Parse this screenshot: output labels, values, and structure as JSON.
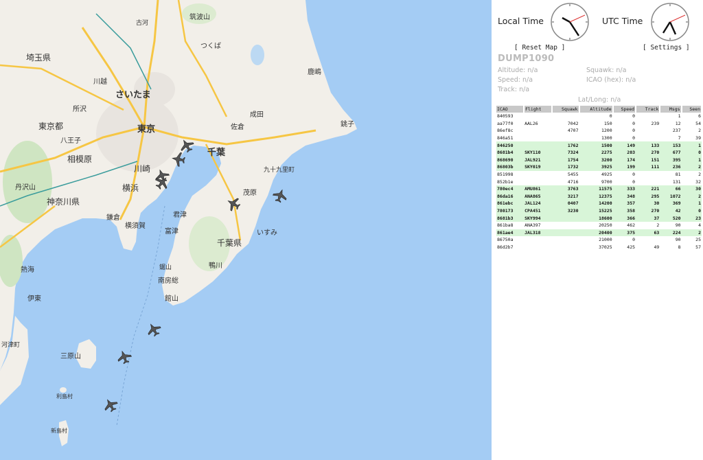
{
  "panel": {
    "local_time_label": "Local Time",
    "utc_time_label": "UTC Time",
    "reset_map_label": "[ Reset Map ]",
    "settings_label": "[ Settings ]",
    "app_title": "DUMP1090",
    "altitude": "Altitude: n/a",
    "squawk": "Squawk: n/a",
    "speed": "Speed: n/a",
    "icao": "ICAO (hex): n/a",
    "track": "Track: n/a",
    "latlong": "Lat/Long: n/a"
  },
  "table": {
    "headers": [
      "ICAO",
      "Flight",
      "Squawk",
      "Altitude",
      "Speed",
      "Track",
      "Msgs",
      "Seen"
    ],
    "rows": [
      {
        "icao": "840593",
        "flight": "",
        "squawk": "",
        "altitude": "0",
        "speed": "0",
        "track": "",
        "msgs": "1",
        "seen": "6",
        "pos": false
      },
      {
        "icao": "aa77f0",
        "flight": "AAL26",
        "squawk": "7042",
        "altitude": "150",
        "speed": "0",
        "track": "239",
        "msgs": "12",
        "seen": "54",
        "pos": false
      },
      {
        "icao": "86ef8c",
        "flight": "",
        "squawk": "4707",
        "altitude": "1200",
        "speed": "0",
        "track": "",
        "msgs": "237",
        "seen": "2",
        "pos": false
      },
      {
        "icao": "846a51",
        "flight": "",
        "squawk": "",
        "altitude": "1300",
        "speed": "0",
        "track": "",
        "msgs": "7",
        "seen": "39",
        "pos": false
      },
      {
        "icao": "846250",
        "flight": "",
        "squawk": "1762",
        "altitude": "1500",
        "speed": "149",
        "track": "133",
        "msgs": "153",
        "seen": "1",
        "pos": true
      },
      {
        "icao": "8681b4",
        "flight": "SKY110",
        "squawk": "7324",
        "altitude": "2275",
        "speed": "203",
        "track": "270",
        "msgs": "677",
        "seen": "0",
        "pos": true
      },
      {
        "icao": "868690",
        "flight": "JAL921",
        "squawk": "1754",
        "altitude": "3200",
        "speed": "174",
        "track": "151",
        "msgs": "395",
        "seen": "1",
        "pos": true
      },
      {
        "icao": "86803b",
        "flight": "SKY019",
        "squawk": "1732",
        "altitude": "3925",
        "speed": "199",
        "track": "111",
        "msgs": "236",
        "seen": "2",
        "pos": true
      },
      {
        "icao": "851998",
        "flight": "",
        "squawk": "5455",
        "altitude": "4925",
        "speed": "0",
        "track": "",
        "msgs": "81",
        "seen": "2",
        "pos": false
      },
      {
        "icao": "852b1e",
        "flight": "",
        "squawk": "4716",
        "altitude": "9700",
        "speed": "0",
        "track": "",
        "msgs": "131",
        "seen": "32",
        "pos": false
      },
      {
        "icao": "780ec4",
        "flight": "AMU861",
        "squawk": "3763",
        "altitude": "11575",
        "speed": "333",
        "track": "221",
        "msgs": "66",
        "seen": "30",
        "pos": true
      },
      {
        "icao": "86da16",
        "flight": "ANA865",
        "squawk": "3217",
        "altitude": "12375",
        "speed": "348",
        "track": "295",
        "msgs": "1072",
        "seen": "2",
        "pos": true
      },
      {
        "icao": "861ebc",
        "flight": "JAL124",
        "squawk": "0407",
        "altitude": "14200",
        "speed": "357",
        "track": "30",
        "msgs": "369",
        "seen": "1",
        "pos": true
      },
      {
        "icao": "780173",
        "flight": "CPA451",
        "squawk": "3230",
        "altitude": "15225",
        "speed": "358",
        "track": "270",
        "msgs": "42",
        "seen": "0",
        "pos": true
      },
      {
        "icao": "8681b3",
        "flight": "SKY994",
        "squawk": "",
        "altitude": "18600",
        "speed": "366",
        "track": "37",
        "msgs": "520",
        "seen": "23",
        "pos": true
      },
      {
        "icao": "861ba8",
        "flight": "ANA397",
        "squawk": "",
        "altitude": "20250",
        "speed": "462",
        "track": "2",
        "msgs": "90",
        "seen": "4",
        "pos": false
      },
      {
        "icao": "861ae4",
        "flight": "JAL318",
        "squawk": "",
        "altitude": "20400",
        "speed": "375",
        "track": "63",
        "msgs": "224",
        "seen": "2",
        "pos": true
      },
      {
        "icao": "86750a",
        "flight": "",
        "squawk": "",
        "altitude": "21000",
        "speed": "0",
        "track": "",
        "msgs": "90",
        "seen": "25",
        "pos": false
      },
      {
        "icao": "86d2b7",
        "flight": "",
        "squawk": "",
        "altitude": "37025",
        "speed": "425",
        "track": "49",
        "msgs": "8",
        "seen": "57",
        "pos": false
      }
    ]
  },
  "map": {
    "icon": "airplane-icon",
    "labels": {
      "saitama_pref": "埼玉県",
      "saitama": "さいたま",
      "tokyo_to": "東京都",
      "tokyo": "東京",
      "kanagawa": "神奈川県",
      "sagamihara": "相模原",
      "yokohama": "横浜",
      "kawasaki": "川崎",
      "chiba_pref": "千葉県",
      "chiba": "千葉",
      "tsukuba": "つくば",
      "kashima": "鹿嶋",
      "choshi": "銚子",
      "narita": "成田",
      "sakura": "佐倉",
      "mobara": "茂原",
      "kimitsu": "君津",
      "futtsu": "富津",
      "tateyama": "館山",
      "yokosuka": "横須賀",
      "kamakura": "鎌倉",
      "kamogawa": "鴨川",
      "minamiboso": "南房総",
      "kujukuri": "九十九里町",
      "isumi": "いすみ",
      "oshima": "三原山",
      "tsukubasan": "筑波山",
      "kawagoe": "川越",
      "tokorozawa": "所沢",
      "hachioji": "八王子",
      "tanzawa": "丹沢山",
      "koga": "古河",
      "ito": "伊東",
      "atami": "熱海",
      "toshima": "利島村",
      "niijima": "新島村",
      "kawazu": "河津町",
      "kyonan": "鋸山"
    }
  },
  "colors": {
    "water": "#a4ccf4",
    "land": "#f2efe9",
    "table_header": "#c8c8c8",
    "highlight_row": "#d8f5d8"
  }
}
